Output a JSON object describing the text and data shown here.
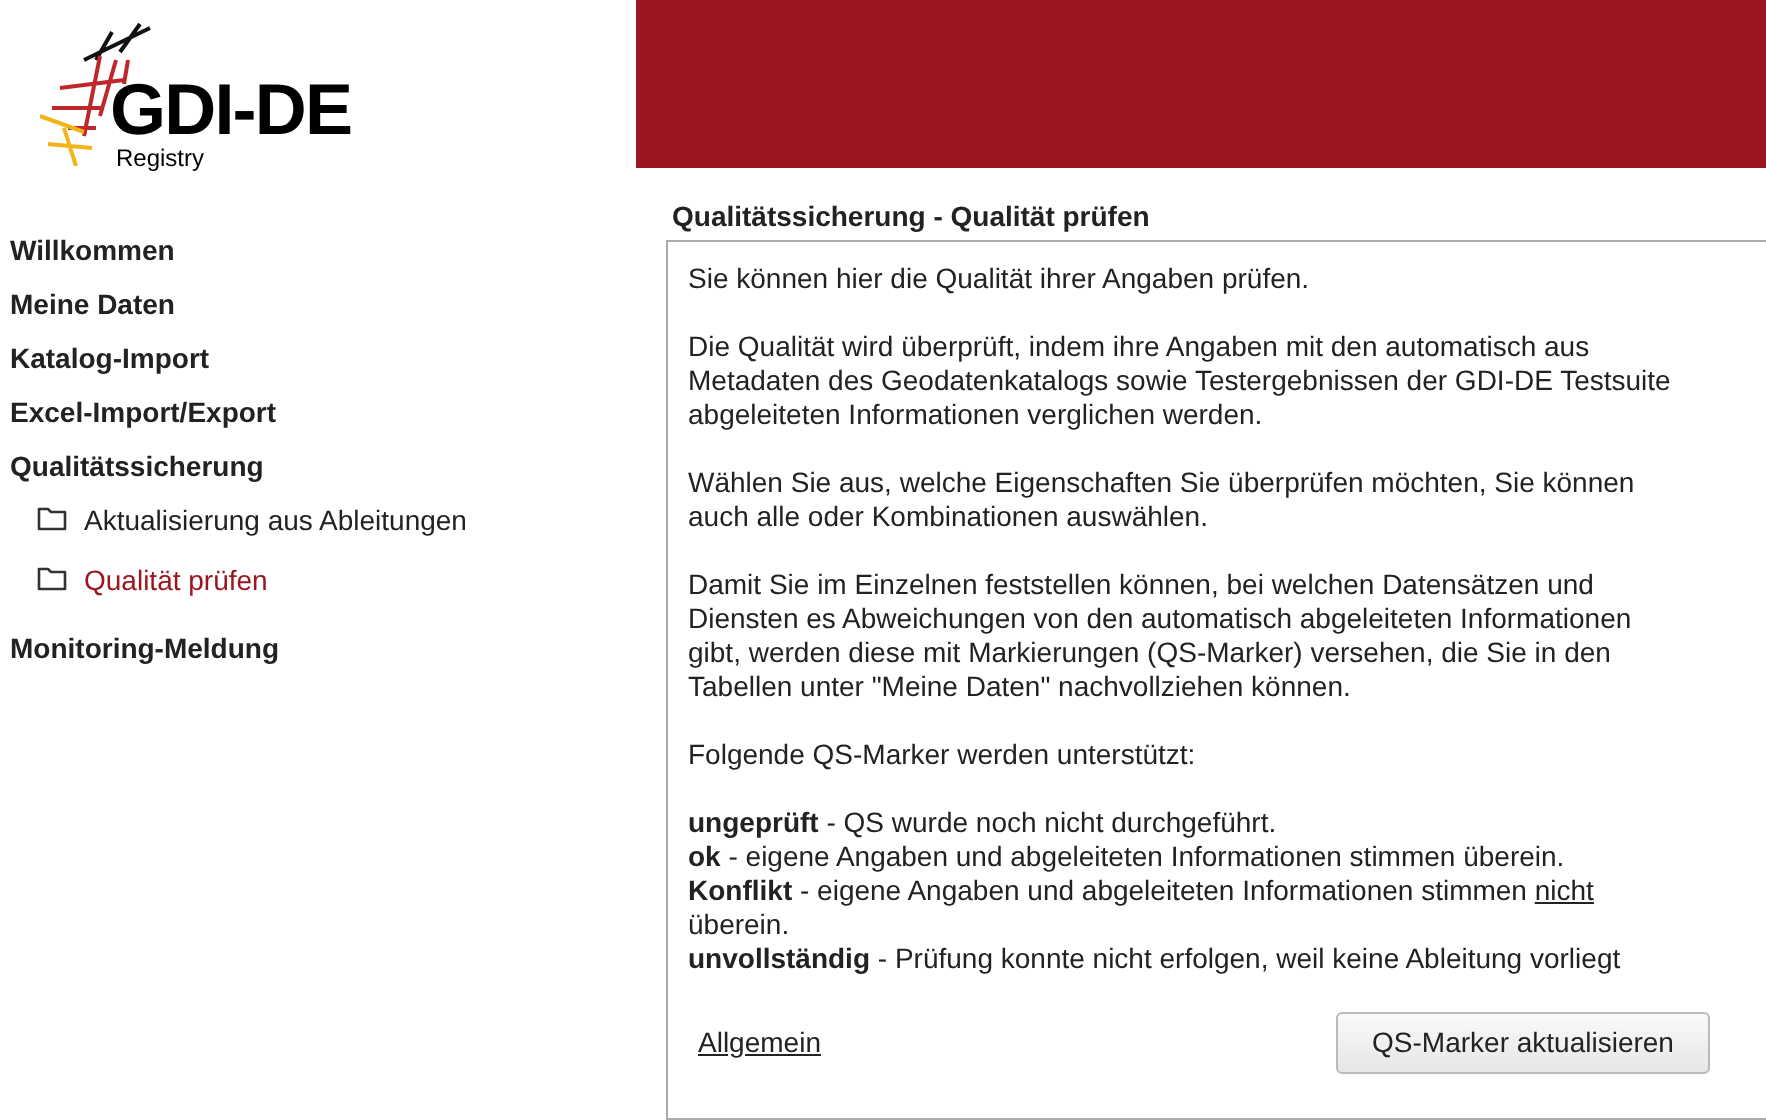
{
  "logo": {
    "title": "GDI-DE",
    "subtitle": "Registry"
  },
  "sidebar": {
    "items": [
      {
        "label": "Willkommen"
      },
      {
        "label": "Meine Daten"
      },
      {
        "label": "Katalog-Import"
      },
      {
        "label": "Excel-Import/Export"
      },
      {
        "label": "Qualitätssicherung",
        "children": [
          {
            "label": "Aktualisierung aus Ableitungen",
            "selected": false
          },
          {
            "label": "Qualität prüfen",
            "selected": true
          }
        ]
      },
      {
        "label": "Monitoring-Meldung"
      }
    ]
  },
  "content": {
    "title": "Qualitätssicherung - Qualität prüfen",
    "paragraphs": [
      "Sie können hier die Qualität ihrer Angaben prüfen.",
      "Die Qualität wird überprüft, indem ihre Angaben mit den automatisch aus Metadaten des Geodatenkatalogs sowie Testergebnissen der GDI-DE Testsuite abgeleiteten Informationen verglichen werden.",
      "Wählen Sie aus, welche Eigenschaften Sie überprüfen möchten, Sie können auch alle oder Kombinationen auswählen.",
      "Damit Sie im Einzelnen feststellen können, bei welchen Datensätzen und Diensten es Abweichungen von den automatisch abgeleiteten Informationen gibt, werden diese mit Markierungen (QS-Marker) versehen, die Sie in den Tabellen unter \"Meine Daten\" nachvollziehen können.",
      "Folgende QS-Marker werden unterstützt:"
    ],
    "markers": [
      {
        "text": "**ungeprüft** - QS wurde noch nicht durchgeführt."
      },
      {
        "text": "**ok** - eigene Angaben und abgeleiteten Informationen stimmen überein."
      },
      {
        "text": "**Konflikt** - eigene Angaben und abgeleiteten Informationen stimmen",
        "underlined": "nicht",
        "text_after": "überein."
      },
      {
        "text": "**unvollständig** - Prüfung konnte nicht erfolgen, weil keine Ableitung vorliegt"
      }
    ],
    "link": "Allgemein",
    "button": "QS-Marker aktualisieren"
  }
}
